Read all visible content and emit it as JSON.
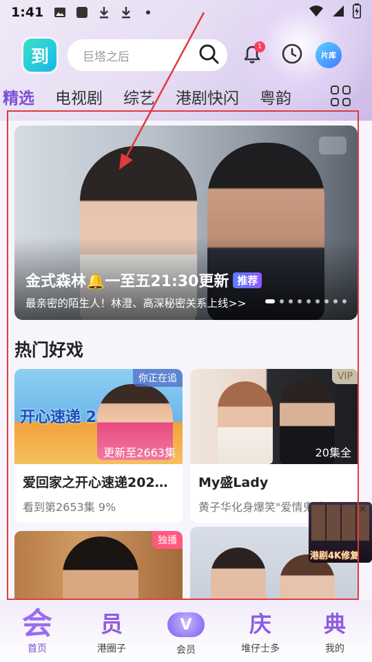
{
  "status_bar": {
    "time": "1:41"
  },
  "header": {
    "logo_text": "到",
    "search_placeholder": "巨塔之后",
    "notification_count": "1",
    "library_label": "片库"
  },
  "tabs": [
    "精选",
    "电视剧",
    "综艺",
    "港剧快闪",
    "粤韵"
  ],
  "hero": {
    "title": "金式森林🔔一至五21:30更新",
    "tag": "推荐",
    "subtitle": "最亲密的陌生人！林澄、高深秘密关系上线>>"
  },
  "section": {
    "title": "热门好戏"
  },
  "cards": [
    {
      "corner": "你正在追",
      "episodes": "更新至2663集",
      "title": "爱回家之开心速递202…",
      "subtitle": "看到第2653集 9%",
      "thumb_text": "开心速递 2025"
    },
    {
      "corner": "VIP",
      "episodes": "20集全",
      "title": "My盛Lady",
      "subtitle": "黄子华化身爆笑\"爱情鬼才\""
    },
    {
      "corner": "独播"
    },
    {
      "corner": ""
    }
  ],
  "float_ad": {
    "text": "港剧4K修复"
  },
  "bottom_nav": [
    {
      "glyph": "会",
      "label": "首页"
    },
    {
      "glyph": "员",
      "label": "港圈子"
    },
    {
      "glyph": "V",
      "label": "会员"
    },
    {
      "glyph": "庆",
      "label": "堆仔士多"
    },
    {
      "glyph": "典",
      "label": "我的"
    }
  ],
  "colors": {
    "accent": "#7d4fd4",
    "annotation": "#e03a3a",
    "badge": "#ff3b5c"
  }
}
